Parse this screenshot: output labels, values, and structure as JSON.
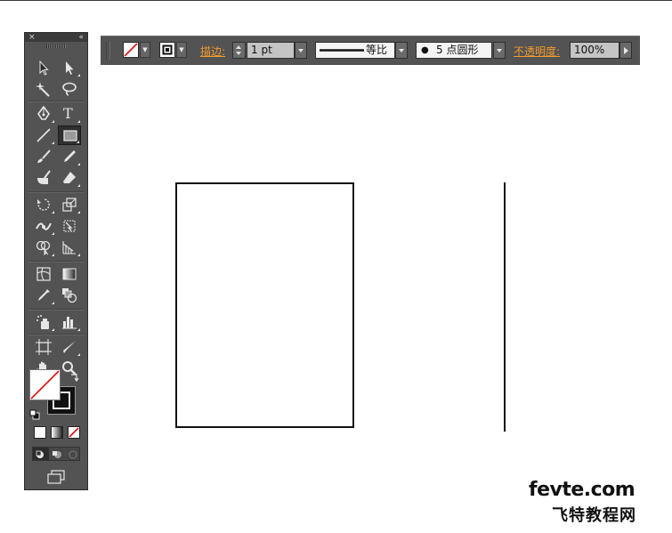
{
  "control_bar": {
    "stroke_label": "描边:",
    "stroke_weight": "1 pt",
    "stroke_profile": "等比",
    "brush_definition": "5 点圆形",
    "opacity_label": "不透明度:",
    "opacity_value": "100%"
  },
  "tools_panel": {
    "close_glyph": "×",
    "collapse_glyph": "«",
    "type_tool_glyph": "T"
  },
  "watermark": {
    "line1": "fevte.com",
    "line2": "飞特教程网"
  },
  "colors": {
    "panel_bg": "#535353",
    "accent_label": "#f39c2a",
    "shape_stroke": "#111111"
  }
}
